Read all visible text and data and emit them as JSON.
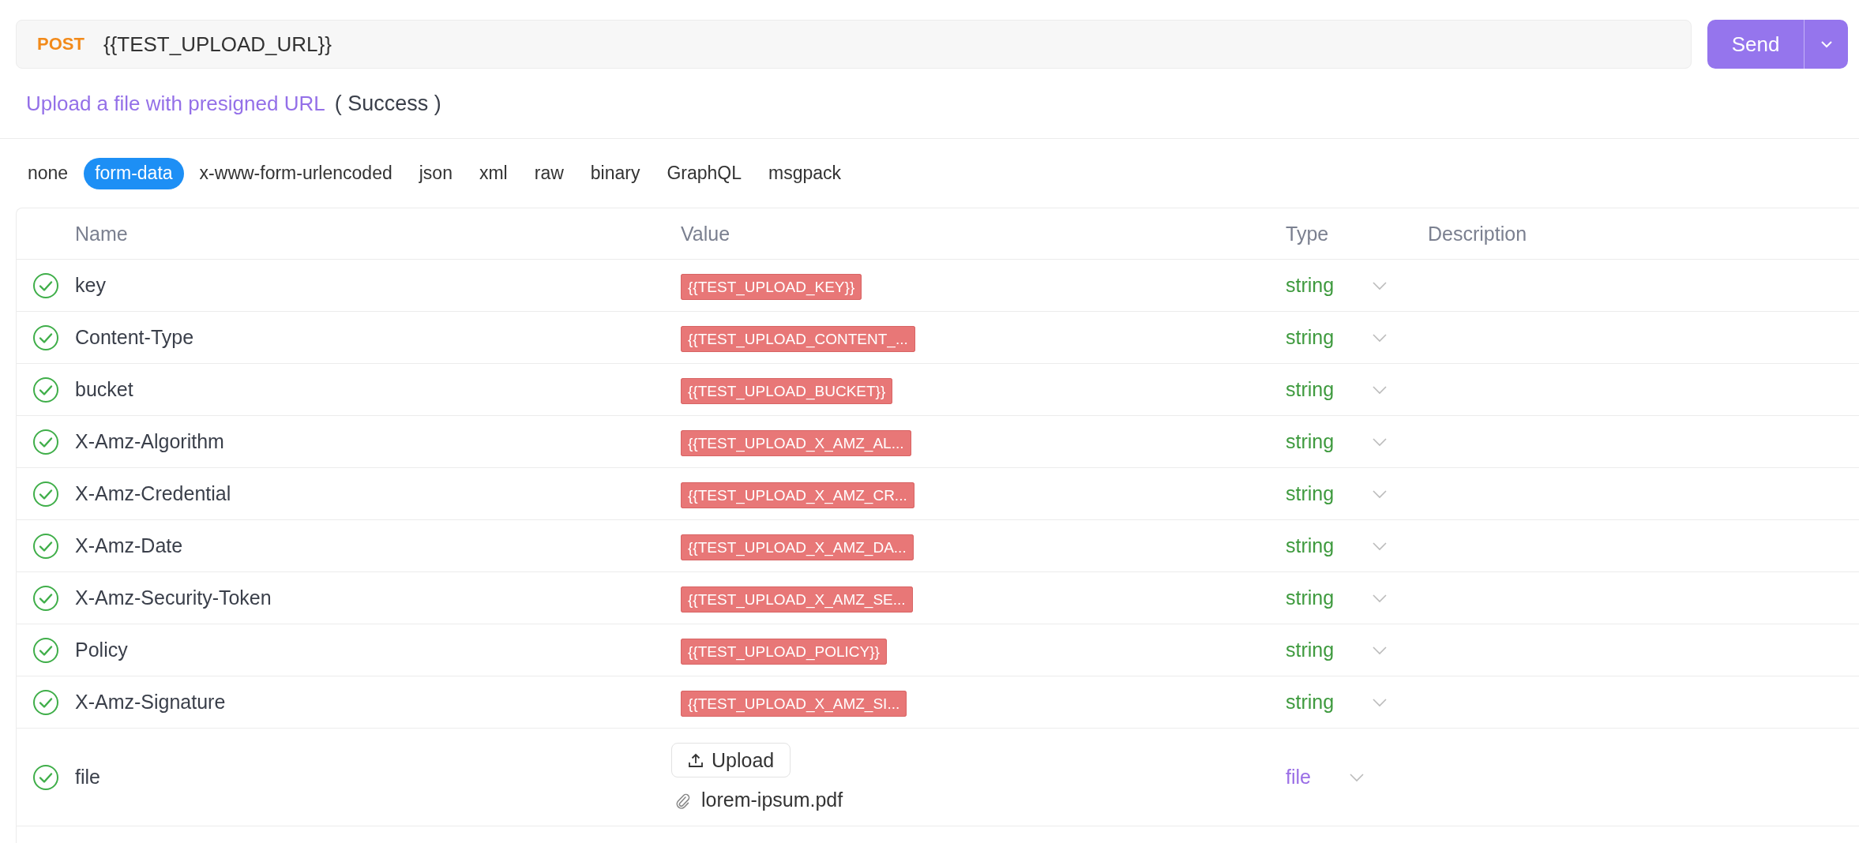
{
  "request": {
    "method": "POST",
    "url": "{{TEST_UPLOAD_URL}}",
    "send_label": "Send"
  },
  "title": {
    "name": "Upload a file with presigned URL",
    "status": "( Success )"
  },
  "body_tabs": [
    {
      "label": "none",
      "selected": false
    },
    {
      "label": "form-data",
      "selected": true
    },
    {
      "label": "x-www-form-urlencoded",
      "selected": false
    },
    {
      "label": "json",
      "selected": false
    },
    {
      "label": "xml",
      "selected": false
    },
    {
      "label": "raw",
      "selected": false
    },
    {
      "label": "binary",
      "selected": false
    },
    {
      "label": "GraphQL",
      "selected": false
    },
    {
      "label": "msgpack",
      "selected": false
    }
  ],
  "table": {
    "columns": [
      "Name",
      "Value",
      "Type",
      "Description"
    ],
    "rows": [
      {
        "enabled": true,
        "kind": "text",
        "name": "key",
        "value": "{{TEST_UPLOAD_KEY}}",
        "type": "string"
      },
      {
        "enabled": true,
        "kind": "text",
        "name": "Content-Type",
        "value": "{{TEST_UPLOAD_CONTENT_...",
        "type": "string"
      },
      {
        "enabled": true,
        "kind": "text",
        "name": "bucket",
        "value": "{{TEST_UPLOAD_BUCKET}}",
        "type": "string"
      },
      {
        "enabled": true,
        "kind": "text",
        "name": "X-Amz-Algorithm",
        "value": "{{TEST_UPLOAD_X_AMZ_AL...",
        "type": "string"
      },
      {
        "enabled": true,
        "kind": "text",
        "name": "X-Amz-Credential",
        "value": "{{TEST_UPLOAD_X_AMZ_CR...",
        "type": "string"
      },
      {
        "enabled": true,
        "kind": "text",
        "name": "X-Amz-Date",
        "value": "{{TEST_UPLOAD_X_AMZ_DA...",
        "type": "string"
      },
      {
        "enabled": true,
        "kind": "text",
        "name": "X-Amz-Security-Token",
        "value": "{{TEST_UPLOAD_X_AMZ_SE...",
        "type": "string"
      },
      {
        "enabled": true,
        "kind": "text",
        "name": "Policy",
        "value": "{{TEST_UPLOAD_POLICY}}",
        "type": "string"
      },
      {
        "enabled": true,
        "kind": "text",
        "name": "X-Amz-Signature",
        "value": "{{TEST_UPLOAD_X_AMZ_SI...",
        "type": "string"
      },
      {
        "enabled": true,
        "kind": "file",
        "name": "file",
        "upload_label": "Upload",
        "file_name": "lorem-ipsum.pdf",
        "type": "file"
      }
    ]
  }
}
